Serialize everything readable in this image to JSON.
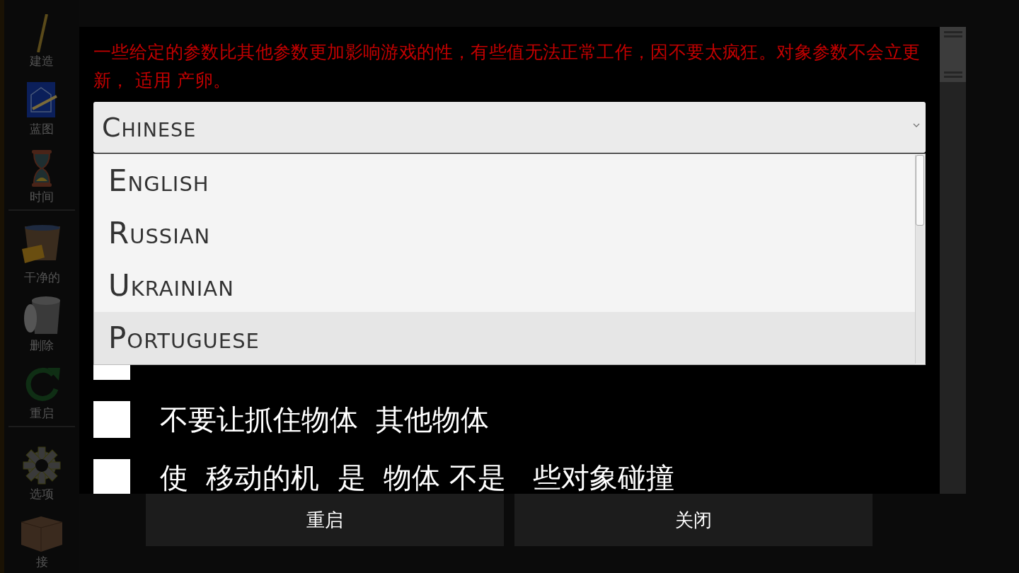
{
  "sidebar": {
    "items": [
      {
        "label": "建造",
        "group_end": false
      },
      {
        "label": "蓝图",
        "group_end": false
      },
      {
        "label": "时间",
        "group_end": true
      },
      {
        "label": "干净的",
        "group_end": false
      },
      {
        "label": "删除",
        "group_end": false
      },
      {
        "label": "重启",
        "group_end": true
      },
      {
        "label": "选项",
        "group_end": false
      },
      {
        "label": "接",
        "group_end": false
      }
    ]
  },
  "notice": "一些给定的参数比其他参数更加影响游戏的性，有些值无法正常工作，因不要太疯狂。对象参数不会立更新， 适用 产卵。",
  "language_select": {
    "value": "Chinese",
    "expanded": true,
    "options": [
      {
        "label": "English",
        "selected": false
      },
      {
        "label": "Russian",
        "selected": false
      },
      {
        "label": "Ukrainian",
        "selected": false
      },
      {
        "label": "Portuguese",
        "selected": true
      }
    ]
  },
  "options": [
    {
      "checked": false
    },
    {
      "label": "不要让抓住物体  其他物体",
      "checked": false
    },
    {
      "label": "使  移动的机  是  物体 不是   些对象碰撞",
      "checked": false
    }
  ],
  "buttons": [
    "重启",
    "关闭"
  ]
}
